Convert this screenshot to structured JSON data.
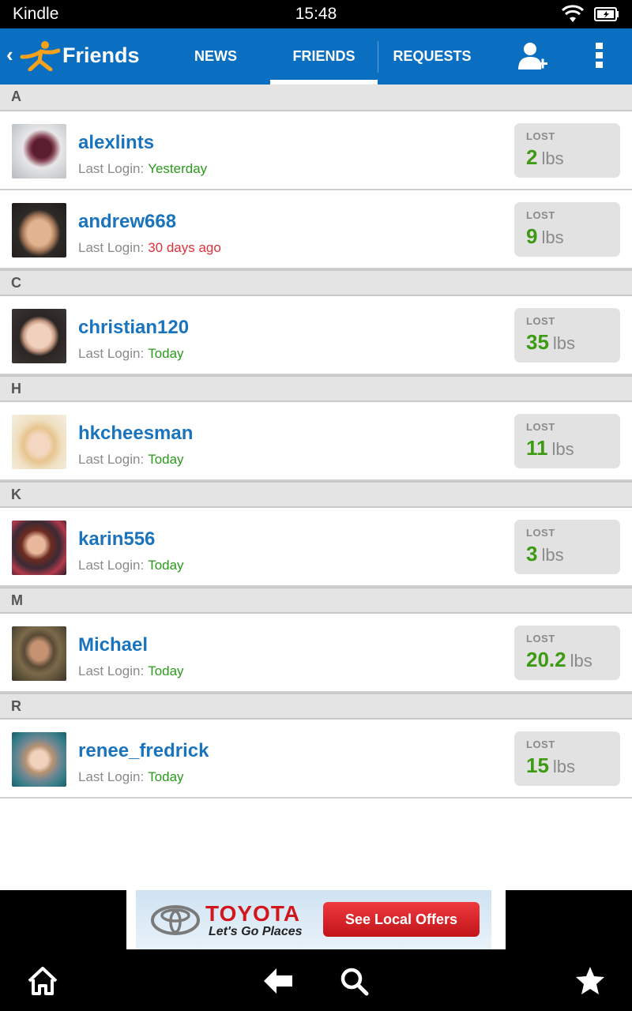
{
  "status_bar": {
    "device": "Kindle",
    "time": "15:48"
  },
  "action_bar": {
    "back_symbol": "‹",
    "title": "Friends",
    "tabs": [
      {
        "label": "NEWS",
        "active": false
      },
      {
        "label": "FRIENDS",
        "active": true
      },
      {
        "label": "REQUESTS",
        "active": false
      }
    ],
    "icons": [
      "running-man-logo-icon",
      "add-friend-icon",
      "overflow-menu-icon"
    ],
    "accent_color": "#0b6fc1"
  },
  "friends": {
    "lost_label": "LOST",
    "last_login_label": "Last Login:",
    "unit": "lbs",
    "sections": [
      {
        "letter": "A",
        "rows": [
          {
            "username": "alexlints",
            "last_login": "Yesterday",
            "login_status": "green",
            "lost": "2"
          },
          {
            "username": "andrew668",
            "last_login": "30 days ago",
            "login_status": "red",
            "lost": "9"
          }
        ]
      },
      {
        "letter": "C",
        "rows": [
          {
            "username": "christian120",
            "last_login": "Today",
            "login_status": "green",
            "lost": "35"
          }
        ]
      },
      {
        "letter": "H",
        "rows": [
          {
            "username": "hkcheesman",
            "last_login": "Today",
            "login_status": "green",
            "lost": "11"
          }
        ]
      },
      {
        "letter": "K",
        "rows": [
          {
            "username": "karin556",
            "last_login": "Today",
            "login_status": "green",
            "lost": "3"
          }
        ]
      },
      {
        "letter": "M",
        "rows": [
          {
            "username": "Michael",
            "last_login": "Today",
            "login_status": "green",
            "lost": "20.2"
          }
        ]
      },
      {
        "letter": "R",
        "rows": [
          {
            "username": "renee_fredrick",
            "last_login": "Today",
            "login_status": "green",
            "lost": "15"
          }
        ]
      }
    ]
  },
  "ad": {
    "brand": "TOYOTA",
    "tagline": "Let's Go Places",
    "cta": "See Local Offers"
  },
  "nav_bar": {
    "icons": [
      "home-icon",
      "back-arrow-icon",
      "search-icon",
      "favorites-star-icon"
    ]
  },
  "colors": {
    "green": "#2a9a1b",
    "red": "#e0303a",
    "username": "#1a74bd"
  }
}
